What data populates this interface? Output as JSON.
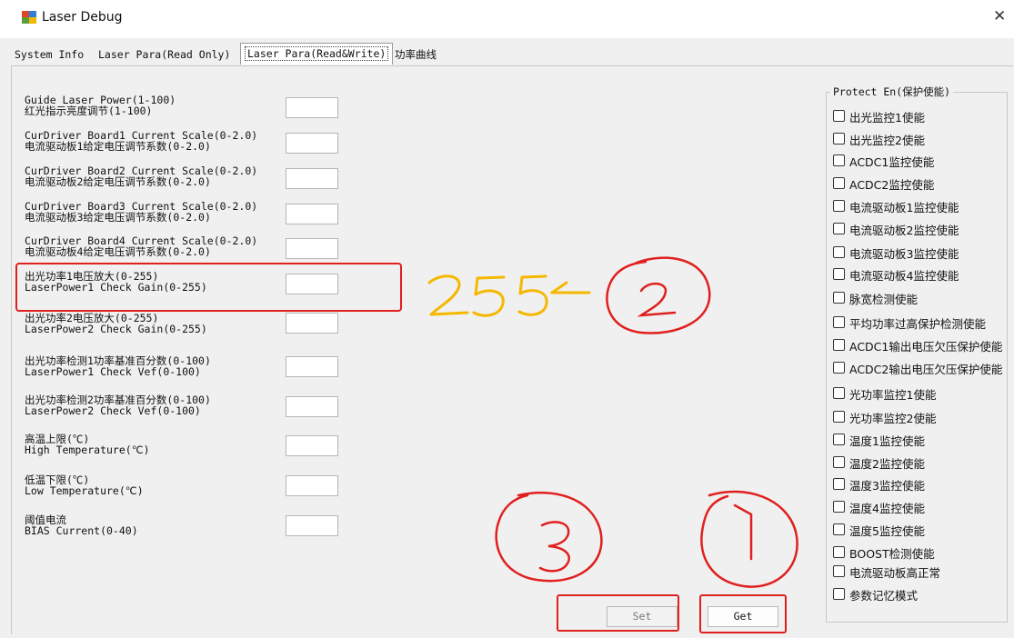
{
  "window": {
    "title": "Laser Debug",
    "close_glyph": "✕"
  },
  "tabs": [
    {
      "label": "System Info"
    },
    {
      "label": "Laser Para(Read Only)"
    },
    {
      "label": "Laser Para(Read&Write)"
    },
    {
      "label": "功率曲线"
    }
  ],
  "params": [
    {
      "line1": "Guide Laser Power(1-100)",
      "line2": "红光指示亮度调节(1-100)",
      "value": ""
    },
    {
      "line1": "CurDriver Board1 Current Scale(0-2.0)",
      "line2": "电流驱动板1给定电压调节系数(0-2.0)",
      "value": ""
    },
    {
      "line1": "CurDriver Board2 Current Scale(0-2.0)",
      "line2": "电流驱动板2给定电压调节系数(0-2.0)",
      "value": ""
    },
    {
      "line1": "CurDriver Board3 Current Scale(0-2.0)",
      "line2": "电流驱动板3给定电压调节系数(0-2.0)",
      "value": ""
    },
    {
      "line1": "CurDriver Board4 Current Scale(0-2.0)",
      "line2": "电流驱动板4给定电压调节系数(0-2.0)",
      "value": ""
    },
    {
      "line1": "出光功率1电压放大(0-255)",
      "line2": "LaserPower1 Check Gain(0-255)",
      "value": ""
    },
    {
      "line1": "出光功率2电压放大(0-255)",
      "line2": "LaserPower2 Check Gain(0-255)",
      "value": ""
    },
    {
      "line1": "出光功率检测1功率基准百分数(0-100)",
      "line2": "LaserPower1 Check Vef(0-100)",
      "value": ""
    },
    {
      "line1": "出光功率检测2功率基准百分数(0-100)",
      "line2": "LaserPower2 Check Vef(0-100)",
      "value": ""
    },
    {
      "line1": "高温上限(℃)",
      "line2": "High Temperature(℃)",
      "value": ""
    },
    {
      "line1": "低温下限(℃)",
      "line2": "Low Temperature(℃)",
      "value": ""
    },
    {
      "line1": "阈值电流",
      "line2": "BIAS Current(0-40)",
      "value": ""
    }
  ],
  "buttons": {
    "set": "Set",
    "get": "Get"
  },
  "protect": {
    "title": "Protect En(保护使能)",
    "items": [
      {
        "label": "出光监控1使能",
        "checked": false
      },
      {
        "label": "出光监控2使能",
        "checked": false
      },
      {
        "label": "ACDC1监控使能",
        "checked": false
      },
      {
        "label": "ACDC2监控使能",
        "checked": false
      },
      {
        "label": "电流驱动板1监控使能",
        "checked": false
      },
      {
        "label": "电流驱动板2监控使能",
        "checked": false
      },
      {
        "label": "电流驱动板3监控使能",
        "checked": false
      },
      {
        "label": "电流驱动板4监控使能",
        "checked": false
      },
      {
        "label": "脉宽检测使能",
        "checked": false
      },
      {
        "label": "平均功率过高保护检测使能",
        "checked": false
      },
      {
        "label": "ACDC1输出电压欠压保护使能",
        "checked": false
      },
      {
        "label": "ACDC2输出电压欠压保护使能",
        "checked": false
      },
      {
        "label": "光功率监控1使能",
        "checked": false
      },
      {
        "label": "光功率监控2使能",
        "checked": false
      },
      {
        "label": "温度1监控使能",
        "checked": false
      },
      {
        "label": "温度2监控使能",
        "checked": false
      },
      {
        "label": "温度3监控使能",
        "checked": false
      },
      {
        "label": "温度4监控使能",
        "checked": false
      },
      {
        "label": "温度5监控使能",
        "checked": false
      },
      {
        "label": "BOOST检测使能",
        "checked": false
      },
      {
        "label": "电流驱动板高正常",
        "checked": false
      },
      {
        "label": "参数记忆模式",
        "checked": false
      }
    ]
  },
  "annotations": {
    "handwritten_value": "255",
    "step_1": "1",
    "step_2": "2",
    "step_3": "3",
    "ink_color": "#e0201e",
    "highlight_color": "#f5b800"
  }
}
